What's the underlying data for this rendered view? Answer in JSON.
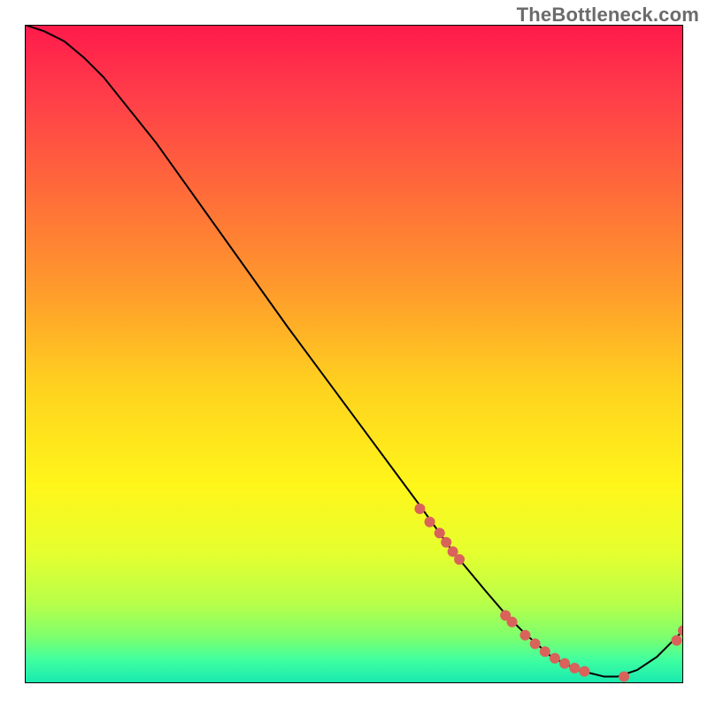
{
  "watermark": "TheBottleneck.com",
  "plot": {
    "margin": 28,
    "size": 800
  },
  "chart_data": {
    "type": "line",
    "title": "",
    "xlabel": "",
    "ylabel": "",
    "xlim": [
      0,
      100
    ],
    "ylim": [
      0,
      100
    ],
    "grid": false,
    "legend": false,
    "background_gradient": {
      "stops": [
        {
          "offset": 0.0,
          "color": "#ff1a4b"
        },
        {
          "offset": 0.1,
          "color": "#ff3b4a"
        },
        {
          "offset": 0.25,
          "color": "#ff6a3a"
        },
        {
          "offset": 0.4,
          "color": "#ff9a2c"
        },
        {
          "offset": 0.55,
          "color": "#ffd21f"
        },
        {
          "offset": 0.7,
          "color": "#fff61a"
        },
        {
          "offset": 0.8,
          "color": "#e6ff2e"
        },
        {
          "offset": 0.88,
          "color": "#b7ff4a"
        },
        {
          "offset": 0.93,
          "color": "#7dff6e"
        },
        {
          "offset": 0.965,
          "color": "#3fffa0"
        },
        {
          "offset": 1.0,
          "color": "#17e8b0"
        }
      ]
    },
    "series": [
      {
        "name": "curve",
        "color": "#000000",
        "x": [
          0,
          3,
          6,
          9,
          12,
          16,
          20,
          30,
          40,
          50,
          60,
          65,
          70,
          73,
          76,
          80,
          84,
          88,
          90,
          93,
          96,
          100
        ],
        "y": [
          100,
          99,
          97.5,
          95,
          92,
          87,
          82,
          68,
          54,
          40.5,
          27,
          20,
          14,
          10.5,
          7.5,
          4,
          2,
          1,
          1,
          2,
          4,
          8
        ]
      }
    ],
    "scatter": {
      "name": "points",
      "color": "#d9625b",
      "radius": 6,
      "x": [
        60,
        61.5,
        63,
        64,
        65,
        66,
        73,
        74,
        76,
        77.5,
        79,
        80.5,
        82,
        83.5,
        85,
        91,
        99,
        100
      ],
      "y": [
        26.5,
        24.5,
        22.8,
        21.4,
        20,
        18.8,
        10.3,
        9.3,
        7.3,
        6.0,
        4.8,
        3.8,
        3.0,
        2.3,
        1.8,
        1.0,
        6.5,
        8.0
      ]
    }
  }
}
